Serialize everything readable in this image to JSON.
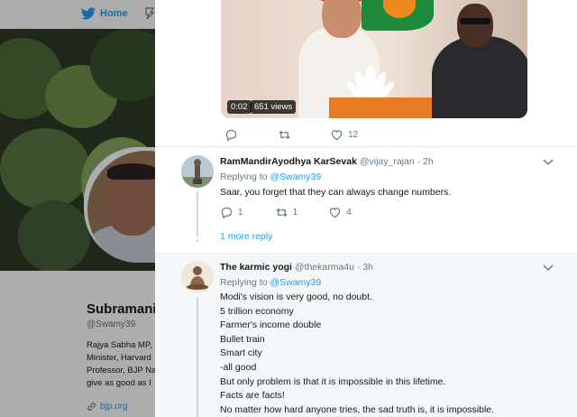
{
  "nav": {
    "home_label": "Home"
  },
  "profile": {
    "name": "Subramani",
    "handle": "@Swamy39",
    "bio_lines": [
      "Rajya Sabha MP,",
      "Minister, Harvard",
      "Professor, BJP Na",
      "give as good as I"
    ],
    "link": "bjp.org"
  },
  "video": {
    "time": "0:02",
    "views": "651 views",
    "likes": "12"
  },
  "replies": [
    {
      "name": "RamMandirAyodhya KarSevak",
      "handle": "@vijay_rajan",
      "time": "2h",
      "replying_label": "Replying to",
      "replying_to": "@Swamy39",
      "lines": [
        "Saar, you forget that they can always change numbers."
      ],
      "reply_count": "1",
      "retweet_count": "1",
      "like_count": "4"
    },
    {
      "name": "The karmic yogi",
      "handle": "@thekarma4u",
      "time": "3h",
      "replying_label": "Replying to",
      "replying_to": "@Swamy39",
      "lines": [
        "Modi's vision is very good, no doubt.",
        "5 trillion economy",
        "Farmer's income double",
        "Bullet train",
        "Smart city",
        "-all good",
        "But only problem is that it is impossible in this lifetime.",
        "Facts are facts!",
        "No matter how hard anyone tries, the sad truth is, it is impossible."
      ]
    }
  ],
  "more_replies_label": "1 more reply",
  "colors": {
    "accent": "#1da1f2",
    "muted": "#657786",
    "text": "#14171a"
  }
}
